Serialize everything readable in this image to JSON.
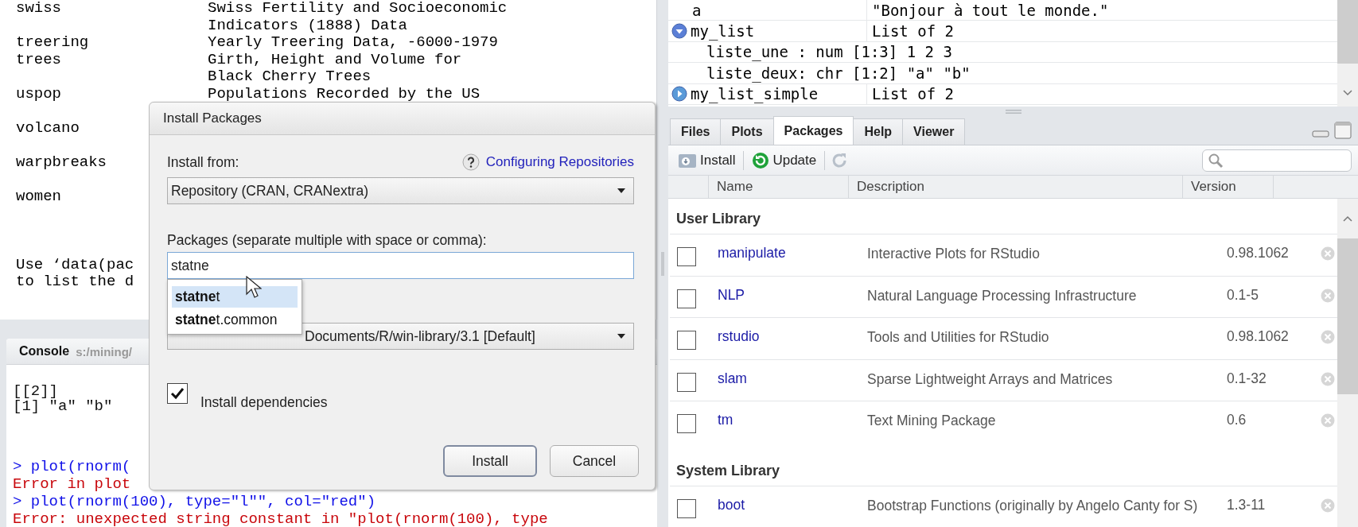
{
  "listing": {
    "rows": [
      {
        "name": "swiss",
        "description": [
          "Swiss Fertility and Socioeconomic",
          "Indicators (1888) Data"
        ]
      },
      {
        "name": "treering",
        "description": [
          "Yearly Treering Data, -6000-1979"
        ]
      },
      {
        "name": "trees",
        "description": [
          "Girth, Height and Volume for",
          "Black Cherry Trees"
        ]
      },
      {
        "name": "uspop",
        "description": [
          "Populations Recorded by the US"
        ]
      },
      {
        "name": "volcano"
      },
      {
        "name": "warpbreaks"
      },
      {
        "name": "women"
      }
    ],
    "footer": [
      "Use ‘data(pac",
      "to list the d"
    ]
  },
  "console": {
    "title": "Console",
    "path": "s:/mining/",
    "lines": [
      {
        "kind": "output",
        "text": "[[2]]"
      },
      {
        "kind": "output",
        "text": "[1] \"a\" \"b\""
      },
      {
        "kind": "input",
        "text": "> plot(rnorm("
      },
      {
        "kind": "error",
        "text": "Error in plot"
      },
      {
        "kind": "input",
        "text": "> plot(rnorm(100), type=\"l\"\", col=\"red\")"
      },
      {
        "kind": "error",
        "text": "Error: unexpected string constant in \"plot(rnorm(100), type"
      }
    ]
  },
  "environment": {
    "rows": [
      {
        "name": "a",
        "value": "\"Bonjour à tout le monde.\""
      },
      {
        "name": "my_list",
        "value": "List of 2",
        "expanded": true,
        "children": [
          {
            "text": "liste_une : num [1:3] 1 2 3"
          },
          {
            "text": "liste_deux: chr [1:2] \"a\" \"b\""
          }
        ]
      },
      {
        "name": "my_list_simple",
        "value": "List of 2",
        "expanded": false
      }
    ]
  },
  "tabs": [
    {
      "label": "Files",
      "selected": false
    },
    {
      "label": "Plots",
      "selected": false
    },
    {
      "label": "Packages",
      "selected": true
    },
    {
      "label": "Help",
      "selected": false
    },
    {
      "label": "Viewer",
      "selected": false
    }
  ],
  "toolbar": {
    "install": "Install",
    "update": "Update"
  },
  "packages": {
    "columns": [
      "Name",
      "Description",
      "Version"
    ],
    "sections": [
      {
        "title": "User Library",
        "rows": [
          {
            "name": "manipulate",
            "description": "Interactive Plots for RStudio",
            "version": "0.98.1062",
            "checked": false
          },
          {
            "name": "NLP",
            "description": "Natural Language Processing Infrastructure",
            "version": "0.1-5",
            "checked": false
          },
          {
            "name": "rstudio",
            "description": "Tools and Utilities for RStudio",
            "version": "0.98.1062",
            "checked": false
          },
          {
            "name": "slam",
            "description": "Sparse Lightweight Arrays and Matrices",
            "version": "0.1-32",
            "checked": false
          },
          {
            "name": "tm",
            "description": "Text Mining Package",
            "version": "0.6",
            "checked": false
          }
        ]
      },
      {
        "title": "System Library",
        "rows": [
          {
            "name": "boot",
            "description": "Bootstrap Functions (originally by Angelo Canty for S)",
            "version": "1.3-11",
            "checked": false
          }
        ]
      }
    ]
  },
  "dialog": {
    "title": "Install Packages",
    "install_from_label": "Install from:",
    "help_link": "Configuring Repositories",
    "repository": "Repository (CRAN, CRANextra)",
    "packages_label": "Packages (separate multiple with space or comma):",
    "packages_value": "statne",
    "suggestions": [
      {
        "text": "**statne**t",
        "selected": true
      },
      {
        "text": "**statne**t.common",
        "selected": false
      }
    ],
    "library": "Documents/R/win-library/3.1 [Default]",
    "install_dependencies": {
      "label": "Install dependencies",
      "checked": true
    },
    "buttons": [
      {
        "label": "Install",
        "kind": "default"
      },
      {
        "label": "Cancel",
        "kind": "normal"
      }
    ]
  }
}
